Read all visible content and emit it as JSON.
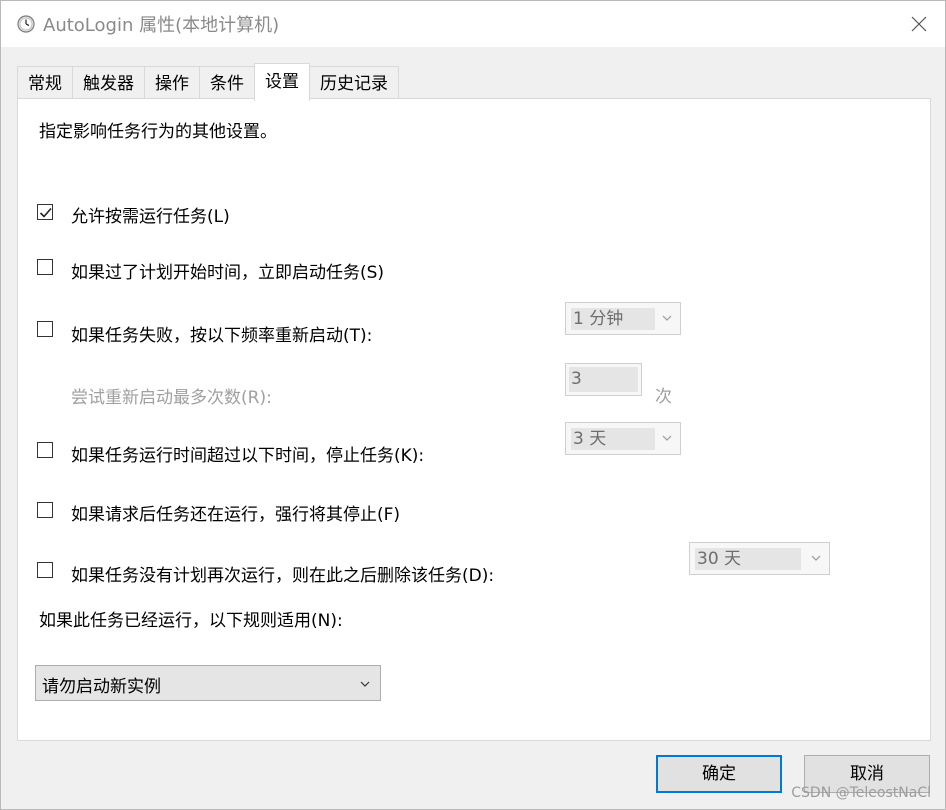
{
  "window": {
    "title": "AutoLogin 属性(本地计算机)",
    "icon": "clock-icon"
  },
  "tabs": [
    {
      "label": "常规",
      "active": false
    },
    {
      "label": "触发器",
      "active": false
    },
    {
      "label": "操作",
      "active": false
    },
    {
      "label": "条件",
      "active": false
    },
    {
      "label": "设置",
      "active": true
    },
    {
      "label": "历史记录",
      "active": false
    }
  ],
  "settings": {
    "description": "指定影响任务行为的其他设置。",
    "allow_on_demand": {
      "label": "允许按需运行任务(L)",
      "checked": true
    },
    "run_asap_missed": {
      "label": "如果过了计划开始时间，立即启动任务(S)",
      "checked": false
    },
    "restart_on_fail": {
      "label": "如果任务失败，按以下频率重新启动(T):",
      "checked": false,
      "interval": "1 分钟"
    },
    "restart_attempts": {
      "label": "尝试重新启动最多次数(R):",
      "value": "3",
      "unit": "次"
    },
    "stop_if_runs_longer": {
      "label": "如果任务运行时间超过以下时间，停止任务(K):",
      "checked": false,
      "duration": "3 天"
    },
    "force_stop": {
      "label": "如果请求后任务还在运行，强行将其停止(F)",
      "checked": false
    },
    "delete_if_not_scheduled": {
      "label": "如果任务没有计划再次运行，则在此之后删除该任务(D):",
      "checked": false,
      "duration": "30 天"
    },
    "already_running_rule": {
      "label": "如果此任务已经运行，以下规则适用(N):",
      "value": "请勿启动新实例"
    }
  },
  "buttons": {
    "ok": "确定",
    "cancel": "取消"
  },
  "watermark": "CSDN @TeleostNaCl",
  "colors": {
    "accent": "#0078d7",
    "disabled_text": "#a0a0a0"
  }
}
